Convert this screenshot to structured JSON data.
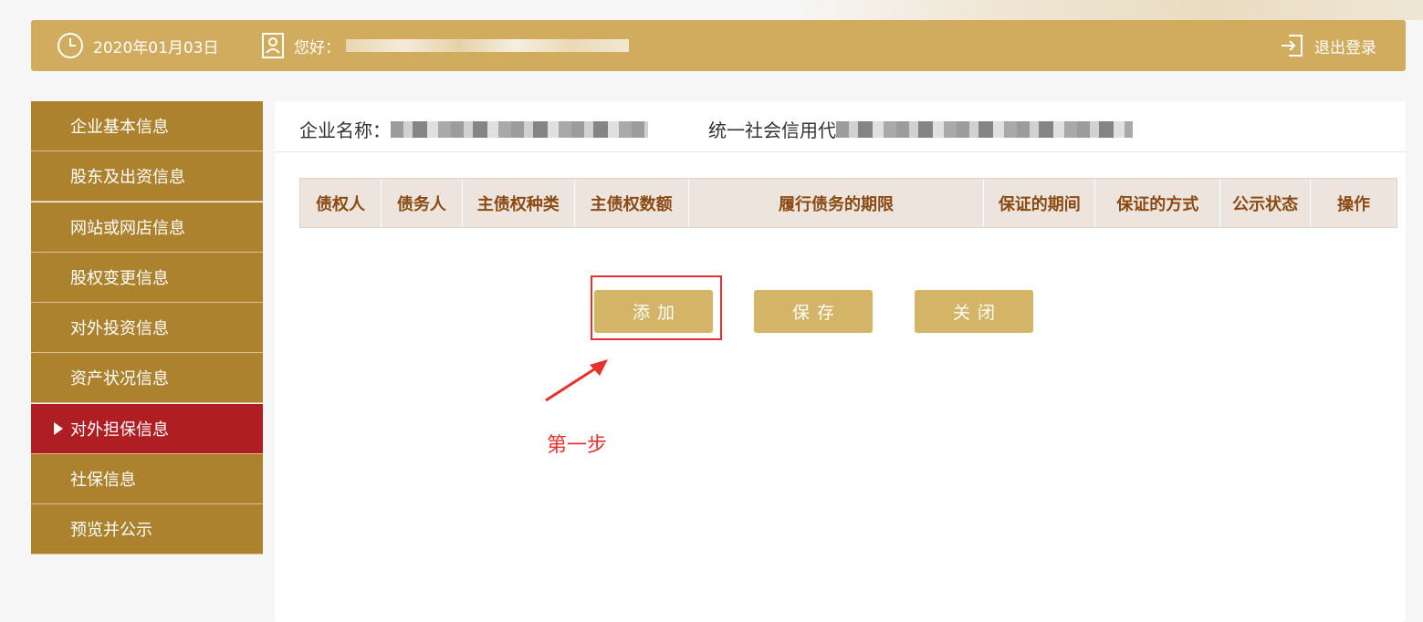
{
  "header": {
    "date": "2020年01月03日",
    "greeting": "您好：",
    "logout_label": "退出登录"
  },
  "sidebar": {
    "items": [
      {
        "label": "企业基本信息",
        "active": false
      },
      {
        "label": "股东及出资信息",
        "active": false
      },
      {
        "label": "网站或网店信息",
        "active": false
      },
      {
        "label": "股权变更信息",
        "active": false
      },
      {
        "label": "对外投资信息",
        "active": false
      },
      {
        "label": "资产状况信息",
        "active": false
      },
      {
        "label": "对外担保信息",
        "active": true
      },
      {
        "label": "社保信息",
        "active": false
      },
      {
        "label": "预览并公示",
        "active": false
      }
    ]
  },
  "main": {
    "company_name_label": "企业名称：",
    "credit_code_label": "统一社会信用代",
    "table": {
      "columns": [
        "债权人",
        "债务人",
        "主债权种类",
        "主债权数额",
        "履行债务的期限",
        "保证的期间",
        "保证的方式",
        "公示状态",
        "操作"
      ]
    },
    "buttons": {
      "add": "添加",
      "save": "保存",
      "close": "关闭"
    },
    "annotation": {
      "step_label": "第一步"
    }
  },
  "colors": {
    "header_bg": "#d1ac5f",
    "nav_bg": "#ad822e",
    "nav_active_bg": "#ae1e22",
    "button_bg": "#d4b466",
    "table_head_bg": "#ece4dd",
    "table_head_text": "#8a4a12",
    "annotation_red": "#e8302c"
  }
}
